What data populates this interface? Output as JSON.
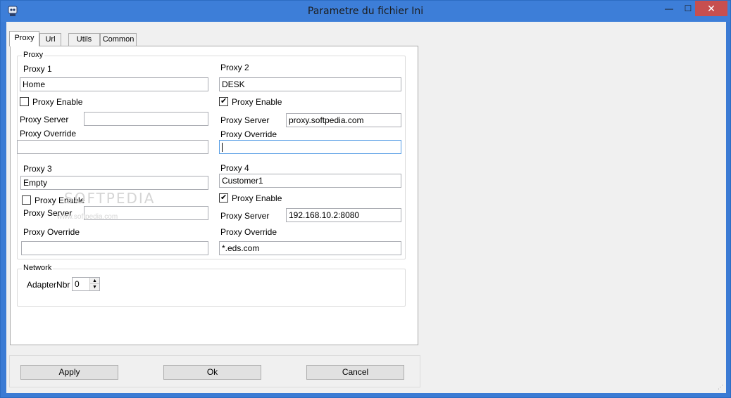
{
  "window": {
    "title": "Parametre du fichier Ini",
    "min_glyph": "—",
    "max_glyph": "☐",
    "close_glyph": "✕"
  },
  "tabs": [
    {
      "label": "Proxy",
      "active": true
    },
    {
      "label": "Url",
      "active": false
    },
    {
      "label": "Utils",
      "active": false
    },
    {
      "label": "Common",
      "active": false
    }
  ],
  "proxy_group": {
    "legend": "Proxy",
    "proxy1": {
      "heading": "Proxy 1",
      "name": "Home",
      "enable_label": "Proxy Enable",
      "enabled": false,
      "server_label": "Proxy Server",
      "server_value": "",
      "override_label": "Proxy Override",
      "override_value": ""
    },
    "proxy2": {
      "heading": "Proxy 2",
      "name": "DESK",
      "enable_label": "Proxy Enable",
      "enabled": true,
      "server_label": "Proxy Server",
      "server_value": "proxy.softpedia.com",
      "override_label": "Proxy Override",
      "override_value": ""
    },
    "proxy3": {
      "heading": "Proxy 3",
      "name": "Empty",
      "enable_label": "Proxy Enable",
      "enabled": false,
      "server_label": "Proxy Server",
      "server_value": "",
      "override_label": "Proxy Override",
      "override_value": ""
    },
    "proxy4": {
      "heading": "Proxy 4",
      "name": "Customer1",
      "enable_label": "Proxy Enable",
      "enabled": true,
      "server_label": "Proxy Server",
      "server_value": "192.168.10.2:8080",
      "override_label": "Proxy Override",
      "override_value": "*.eds.com"
    }
  },
  "network_group": {
    "legend": "Network",
    "adapter_label": "AdapterNbr",
    "adapter_value": "0"
  },
  "watermark": {
    "main": "SOFTPEDIA",
    "sub": "www.softpedia.com"
  },
  "buttons": {
    "apply": "Apply",
    "ok": "Ok",
    "cancel": "Cancel"
  }
}
